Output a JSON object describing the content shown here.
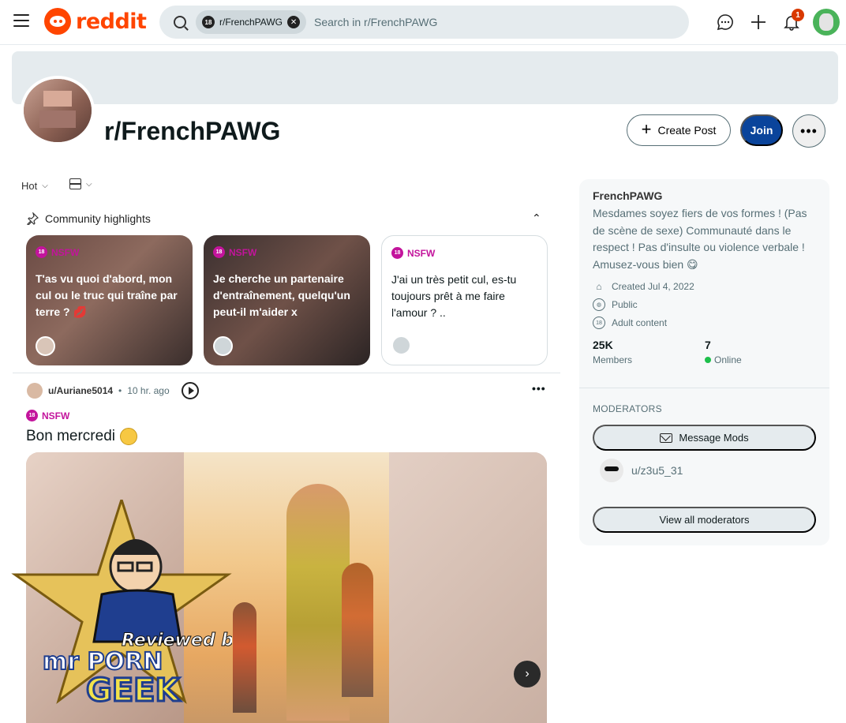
{
  "header": {
    "logo_text": "reddit",
    "search_chip": "r/FrenchPAWG",
    "search_chip_badge": "18",
    "search_placeholder": "Search in r/FrenchPAWG",
    "notification_count": "1",
    "icons": [
      "menu-icon",
      "chat-icon",
      "plus-icon",
      "bell-icon",
      "user-avatar"
    ]
  },
  "community": {
    "name": "r/FrenchPAWG",
    "create_post_label": "Create Post",
    "join_label": "Join",
    "more_label": "•••"
  },
  "feed": {
    "sort_label": "Hot",
    "highlights_title": "Community highlights",
    "highlights": [
      {
        "tag": "NSFW",
        "text": "T'as vu quoi d'abord, mon cul ou le truc qui traîne par terre ? 💋"
      },
      {
        "tag": "NSFW",
        "text": "Je cherche un partenaire d'entraînement, quelqu'un peut-il m'aider x"
      },
      {
        "tag": "NSFW",
        "text": "J'ai un très petit cul, es-tu toujours prêt à me faire l'amour ? .."
      }
    ],
    "post": {
      "author": "u/Auriane5014",
      "separator": "•",
      "time": "10 hr. ago",
      "tag": "NSFW",
      "title": "Bon mercredi",
      "more_label": "•••"
    }
  },
  "sidebar": {
    "name": "FrenchPAWG",
    "description": "Mesdames soyez fiers de vos formes ! (Pas de scène de sexe) Communauté dans le respect ! Pas d'insulte ou violence verbale ! Amusez-vous bien 😋",
    "created": "Created Jul 4, 2022",
    "visibility": "Public",
    "content_rating": "Adult content",
    "members_count": "25K",
    "members_label": "Members",
    "online_count": "7",
    "online_label": "Online",
    "moderators_heading": "MODERATORS",
    "message_mods_label": "Message Mods",
    "moderator": "u/z3u5_31",
    "view_all_label": "View all moderators"
  },
  "watermark": {
    "line1": "Reviewed by",
    "line2": "mr PORN",
    "line3": "GEEK"
  },
  "colors": {
    "brand": "#ff4500",
    "join": "#0a449b",
    "nsfw": "#c3149c",
    "online": "#1dbf4b"
  }
}
